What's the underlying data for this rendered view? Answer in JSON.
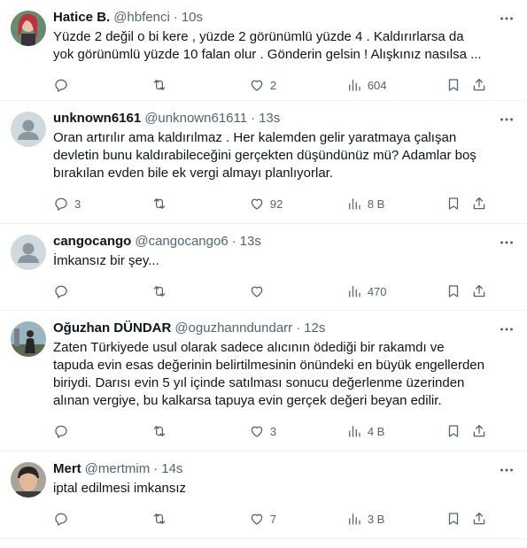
{
  "tweets": [
    {
      "name": "Hatice B.",
      "handle": "@hbfenci",
      "time": "10s",
      "text": "Yüzde 2 değil o bi kere , yüzde 2 görünümlü yüzde 4 . Kaldırırlarsa da yok görünümlü yüzde 10 falan olur . Gönderin gelsin ! Alışkınız nasılsa ...",
      "replies": "",
      "retweets": "",
      "likes": "2",
      "views": "604",
      "avatar": "photo"
    },
    {
      "name": "unknown6161",
      "handle": "@unknown61611",
      "time": "13s",
      "text": "Oran artırılır ama kaldırılmaz . Her kalemden gelir yaratmaya çalışan devletin bunu kaldırabileceğini gerçekten düşündünüz mü? Adamlar boş bırakılan evden bile ek vergi almayı planlıyorlar.",
      "replies": "3",
      "retweets": "",
      "likes": "92",
      "views": "8 B",
      "avatar": "default"
    },
    {
      "name": "cangocango",
      "handle": "@cangocango6",
      "time": "13s",
      "text": "İmkansız bir şey...",
      "replies": "",
      "retweets": "",
      "likes": "",
      "views": "470",
      "avatar": "default"
    },
    {
      "name": "Oğuzhan DÜNDAR",
      "handle": "@oguzhanndundarr",
      "time": "12s",
      "text": "Zaten Türkiyede usul olarak sadece alıcının ödediği bir rakamdı ve tapuda evin esas değerinin belirtilmesinin önündeki en büyük engellerden biriydi. Darısı evin 5 yıl içinde satılması sonucu değerlenme üzerinden alınan vergiye, bu kalkarsa tapuya evin gerçek değeri beyan edilir.",
      "replies": "",
      "retweets": "",
      "likes": "3",
      "views": "4 B",
      "avatar": "photo"
    },
    {
      "name": "Mert",
      "handle": "@mertmim",
      "time": "14s",
      "text": "iptal edilmesi imkansız",
      "replies": "",
      "retweets": "",
      "likes": "7",
      "views": "3 B",
      "avatar": "photo"
    }
  ],
  "separator": "·",
  "colors": {
    "text": "#0f1419",
    "secondary": "#536471",
    "border": "#eff3f4",
    "default_avatar": "#cfd9de"
  }
}
